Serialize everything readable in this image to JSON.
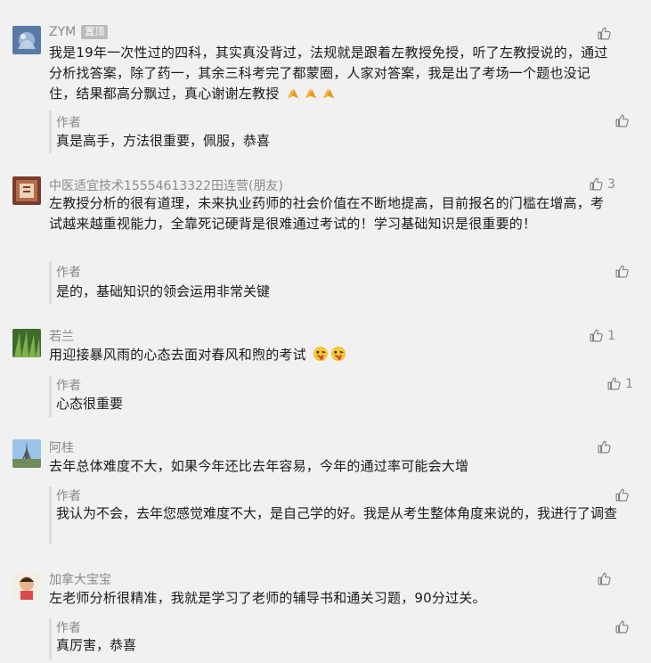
{
  "comments": [
    {
      "nickname": "ZYM",
      "badge": "置顶",
      "text": "我是19年一次性过的四科，其实真没背过，法规就是跟着左教授免授，听了左教授说的，通过分析找答案，除了药一，其余三科考完了都蒙圈，人家对答案，我是出了考场一个题也没记住，结果都高分飘过，真心谢谢左教授",
      "emojis": [
        "pray-emoji",
        "pray-emoji",
        "pray-emoji"
      ],
      "likes": "",
      "reply": {
        "author": "作者",
        "text": "真是高手，方法很重要，佩服，恭喜",
        "likes": ""
      }
    },
    {
      "nickname": "中医适宜技术15554613322田连营(朋友)",
      "text": "左教授分析的很有道理，未来执业药师的社会价值在不断地提高，目前报名的门槛在增高，考试越来越重视能力，全靠死记硬背是很难通过考试的！学习基础知识是很重要的！",
      "likes": "3",
      "reply": {
        "author": "作者",
        "text": "是的，基础知识的领会运用非常关键",
        "likes": ""
      }
    },
    {
      "nickname": "若兰",
      "text": "用迎接暴风雨的心态去面对春风和煦的考试",
      "emojis": [
        "tongue-emoji",
        "tongue-emoji"
      ],
      "likes": "1",
      "reply": {
        "author": "作者",
        "text": "心态很重要",
        "likes": "1"
      }
    },
    {
      "nickname": "阿桂",
      "text": "去年总体难度不大，如果今年还比去年容易，今年的通过率可能会大增",
      "likes": "",
      "reply": {
        "author": "作者",
        "text": "我认为不会，去年您感觉难度不大，是自己学的好。我是从考生整体角度来说的，我进行了调查",
        "likes": ""
      }
    },
    {
      "nickname": "加拿大宝宝",
      "text": "左老师分析很精准，我就是学习了老师的辅导书和通关习题，90分过关。",
      "likes": "",
      "reply": {
        "author": "作者",
        "text": "真厉害，恭喜",
        "likes": ""
      }
    }
  ]
}
